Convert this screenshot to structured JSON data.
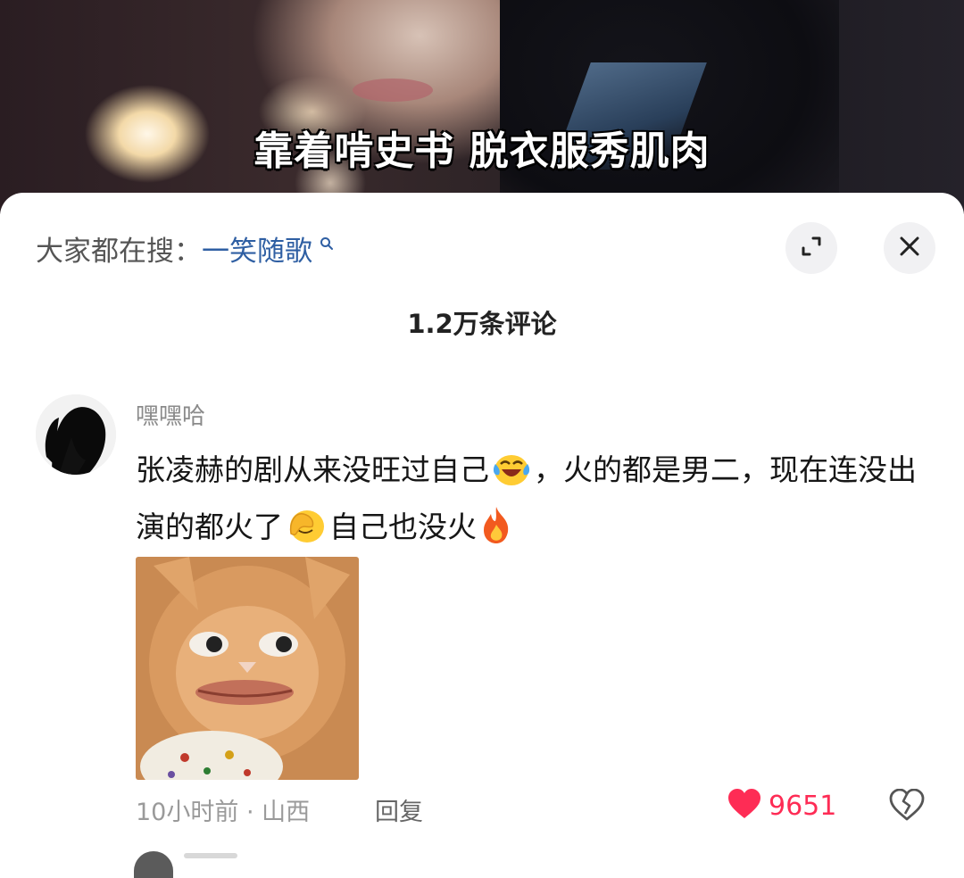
{
  "video": {
    "caption": "靠着啃史书 脱衣服秀肌肉"
  },
  "search": {
    "prefix": "大家都在搜：",
    "keyword": "一笑随歌"
  },
  "comments_header": {
    "count_label": "1.2万条评论"
  },
  "comment": {
    "username": "嘿嘿哈",
    "text_part1": "张凌赫的剧从来没旺过自己",
    "text_part2": "，火的都是男二，现在连没出演的都火了",
    "text_part3": "自己也没火",
    "time": "10小时前",
    "location": "山西",
    "reply_label": "回复",
    "like_count": "9651"
  },
  "icons": {
    "search": "search-icon",
    "collapse": "collapse-icon",
    "close": "close-icon",
    "like": "heart-icon",
    "dislike": "broken-heart-icon",
    "emoji1": "laugh-cry-emoji-icon",
    "emoji2": "facepalm-emoji-icon",
    "emoji3": "fire-emoji-icon"
  },
  "colors": {
    "like": "#fe2c55",
    "keyword": "#2f5fa3"
  }
}
